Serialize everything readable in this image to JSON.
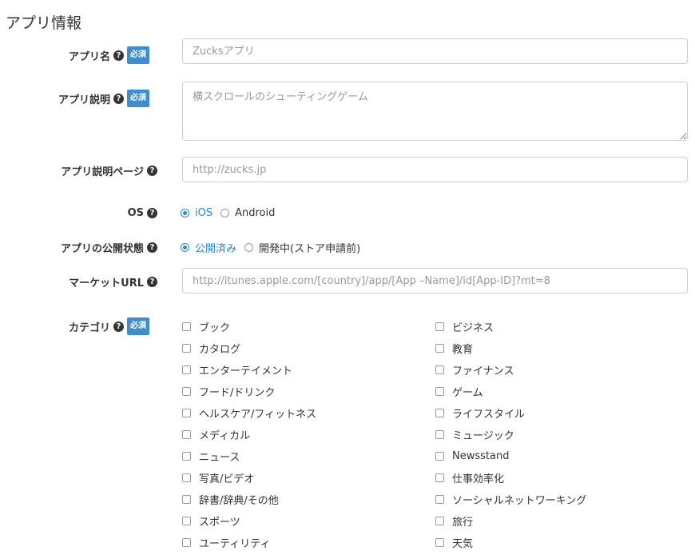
{
  "section_title": "アプリ情報",
  "required_label": "必須",
  "help_glyph": "?",
  "fields": {
    "app_name": {
      "label": "アプリ名",
      "placeholder": "Zucksアプリ"
    },
    "app_desc": {
      "label": "アプリ説明",
      "placeholder": "横スクロールのシューティングゲーム"
    },
    "app_page": {
      "label": "アプリ説明ページ",
      "placeholder": "http://zucks.jp"
    },
    "os": {
      "label": "OS",
      "options": [
        {
          "label": "iOS",
          "checked": true
        },
        {
          "label": "Android",
          "checked": false
        }
      ]
    },
    "status": {
      "label": "アプリの公開状態",
      "options": [
        {
          "label": "公開済み",
          "checked": true
        },
        {
          "label": "開発中(ストア申請前)",
          "checked": false
        }
      ]
    },
    "market_url": {
      "label": "マーケットURL",
      "placeholder": "http://itunes.apple.com/[country]/app/[App –Name]/id[App-ID]?mt=8"
    },
    "category": {
      "label": "カテゴリ",
      "left": [
        "ブック",
        "カタログ",
        "エンターテイメント",
        "フード/ドリンク",
        "ヘルスケア/フィットネス",
        "メディカル",
        "ニュース",
        "写真/ビデオ",
        "辞書/辞典/その他",
        "スポーツ",
        "ユーティリティ"
      ],
      "right": [
        "ビジネス",
        "教育",
        "ファイナンス",
        "ゲーム",
        "ライフスタイル",
        "ミュージック",
        "Newsstand",
        "仕事効率化",
        "ソーシャルネットワーキング",
        "旅行",
        "天気"
      ]
    }
  },
  "colors": {
    "accent": "#2a84e0",
    "required_badge": "#3d8ed1",
    "input_border": "#cccccc",
    "placeholder": "#999999"
  }
}
